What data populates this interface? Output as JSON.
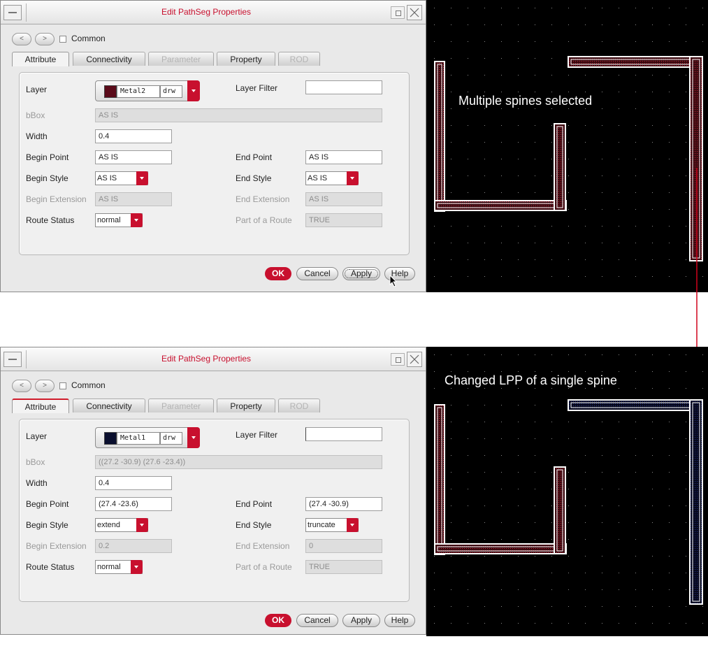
{
  "top": {
    "dialog": {
      "title": "Edit PathSeg Properties",
      "nav": {
        "prev": "<",
        "next": ">",
        "common_label": "Common"
      },
      "tabs": [
        "Attribute",
        "Connectivity",
        "Parameter",
        "Property",
        "ROD"
      ],
      "active_tab": "Attribute",
      "disabled_tabs": [
        "Parameter",
        "ROD"
      ],
      "fields": {
        "layer_label": "Layer",
        "layer_name": "Metal2",
        "layer_purpose": "drw",
        "layer_color": "#5b0b1a",
        "layer_filter_label": "Layer Filter",
        "layer_filter_value": "",
        "bbox_label": "bBox",
        "bbox_value": "AS IS",
        "width_label": "Width",
        "width_value": "0.4",
        "begin_point_label": "Begin Point",
        "begin_point_value": "AS IS",
        "end_point_label": "End Point",
        "end_point_value": "AS IS",
        "begin_style_label": "Begin Style",
        "begin_style_value": "AS IS",
        "end_style_label": "End Style",
        "end_style_value": "AS IS",
        "begin_ext_label": "Begin Extension",
        "begin_ext_value": "AS IS",
        "end_ext_label": "End Extension",
        "end_ext_value": "AS IS",
        "route_status_label": "Route Status",
        "route_status_value": "normal",
        "part_of_route_label": "Part of a Route",
        "part_of_route_value": "TRUE"
      },
      "buttons": {
        "ok": "OK",
        "cancel": "Cancel",
        "apply": "Apply",
        "help": "Help"
      }
    },
    "canvas_caption": "Multiple spines selected"
  },
  "bottom": {
    "dialog": {
      "title": "Edit PathSeg Properties",
      "nav": {
        "prev": "<",
        "next": ">",
        "common_label": "Common"
      },
      "tabs": [
        "Attribute",
        "Connectivity",
        "Parameter",
        "Property",
        "ROD"
      ],
      "active_tab": "Attribute",
      "disabled_tabs": [
        "Parameter",
        "ROD"
      ],
      "fields": {
        "layer_label": "Layer",
        "layer_name": "Metal1",
        "layer_purpose": "drw",
        "layer_color": "#0a0f2e",
        "layer_filter_label": "Layer Filter",
        "layer_filter_value": "",
        "bbox_label": "bBox",
        "bbox_value": "((27.2 -30.9) (27.6 -23.4))",
        "width_label": "Width",
        "width_value": "0.4",
        "begin_point_label": "Begin Point",
        "begin_point_value": "(27.4 -23.6)",
        "end_point_label": "End Point",
        "end_point_value": "(27.4 -30.9)",
        "begin_style_label": "Begin Style",
        "begin_style_value": "extend",
        "end_style_label": "End Style",
        "end_style_value": "truncate",
        "begin_ext_label": "Begin Extension",
        "begin_ext_value": "0.2",
        "end_ext_label": "End Extension",
        "end_ext_value": "0",
        "route_status_label": "Route Status",
        "route_status_value": "normal",
        "part_of_route_label": "Part of a Route",
        "part_of_route_value": "TRUE"
      },
      "buttons": {
        "ok": "OK",
        "cancel": "Cancel",
        "apply": "Apply",
        "help": "Help"
      }
    },
    "canvas_caption": "Changed LPP of a single spine"
  },
  "colors": {
    "title_red": "#c8102e",
    "metal2_fill": "#5b0b1a",
    "metal1_fill": "#0a0f2e",
    "arrow": "#d0021b"
  }
}
